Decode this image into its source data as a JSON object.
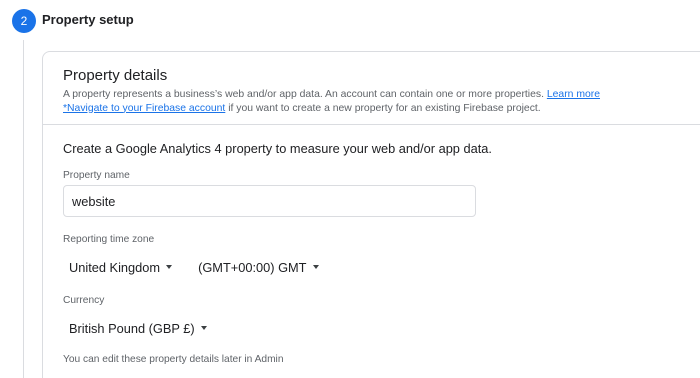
{
  "step": {
    "number": "2",
    "title": "Property setup"
  },
  "details": {
    "title": "Property details",
    "desc_text": "A property represents a business’s web and/or app data. An account can contain one or more properties.",
    "learn_more": "Learn more",
    "firebase_link": "*Navigate to your Firebase account",
    "desc_suffix": "if you want to create a new property for an existing Firebase project."
  },
  "form": {
    "intro": "Create a Google Analytics 4 property to measure your web and/or app data.",
    "property_name_label": "Property name",
    "property_name_value": "website",
    "timezone_label": "Reporting time zone",
    "country_value": "United Kingdom",
    "timezone_value": "(GMT+00:00) GMT",
    "currency_label": "Currency",
    "currency_value": "British Pound (GBP £)",
    "footnote": "You can edit these property details later in Admin"
  },
  "colors": {
    "accent": "#1a73e8",
    "border": "#dadce0",
    "muted_text": "#5f6368"
  }
}
